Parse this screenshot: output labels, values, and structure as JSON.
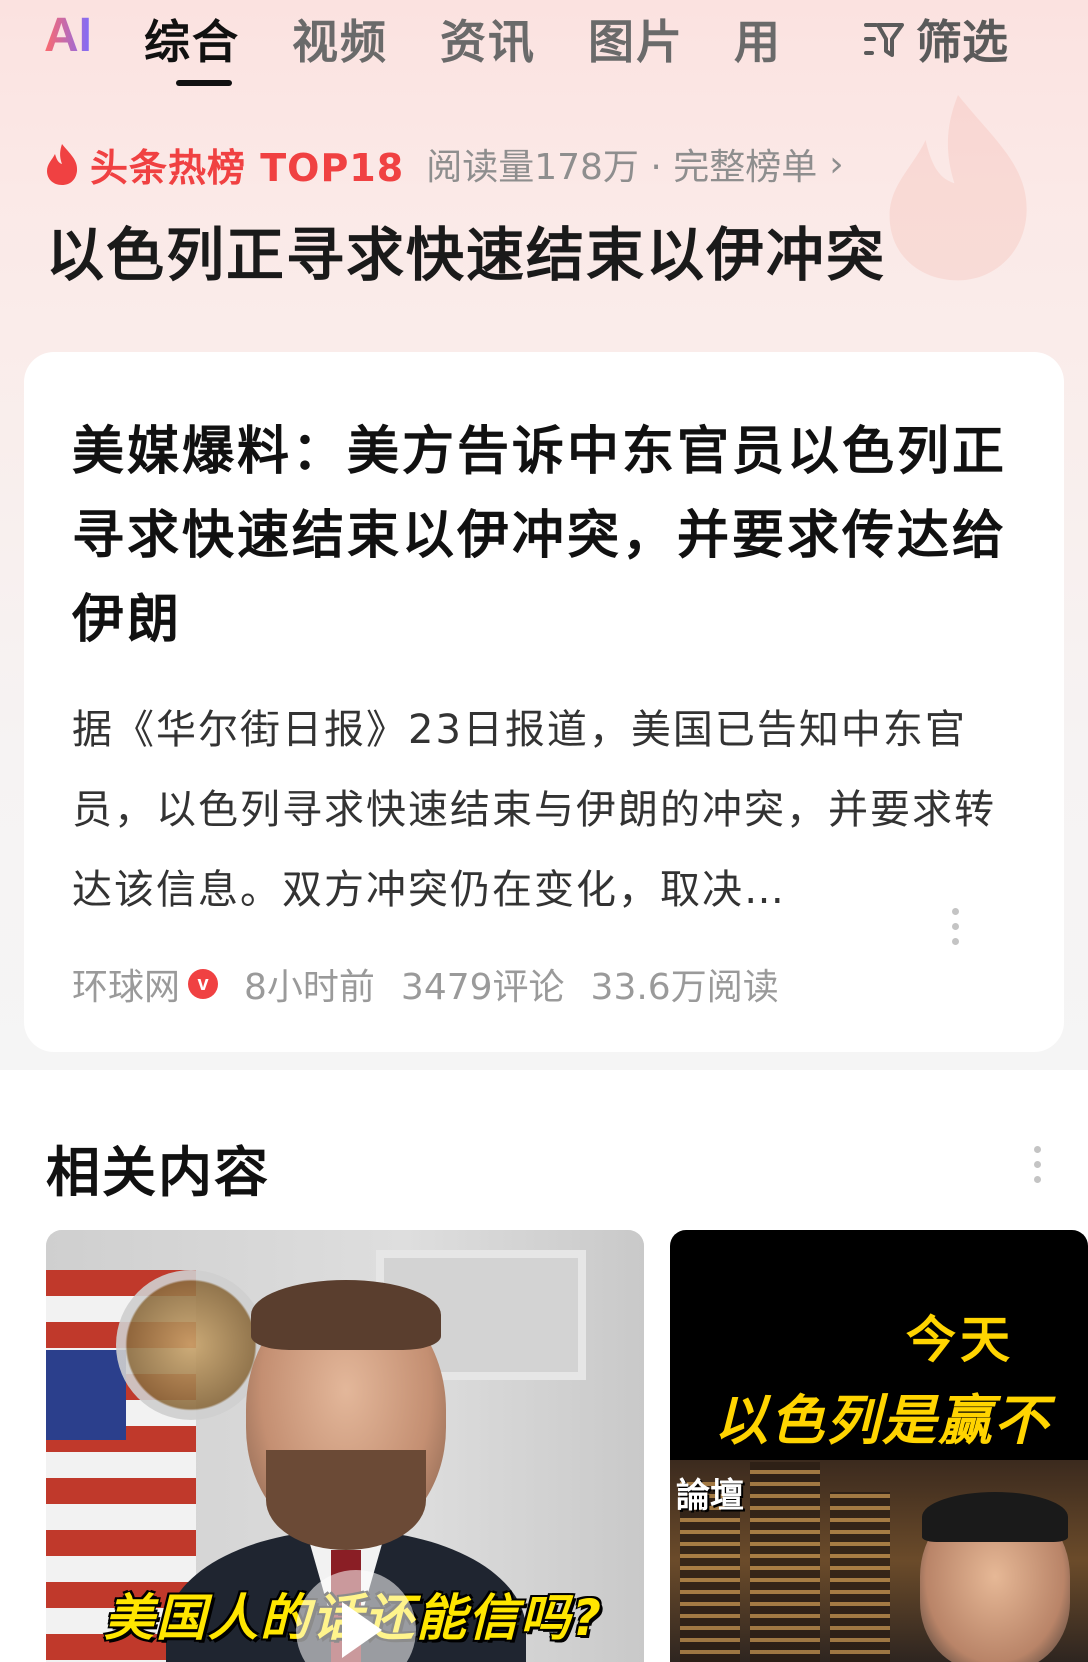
{
  "tabs": {
    "ai": "AI",
    "items": [
      "综合",
      "视频",
      "资讯",
      "图片",
      "用"
    ],
    "active_index": 0,
    "filter_label": "筛选"
  },
  "hot": {
    "badge": "头条热榜 TOP18",
    "meta": "阅读量178万 · 完整榜单",
    "chevron": "›",
    "headline": "以色列正寻求快速结束以伊冲突"
  },
  "article": {
    "title": "美媒爆料：美方告诉中东官员以色列正寻求快速结束以伊冲突，并要求传达给伊朗",
    "abstract": "据《华尔街日报》23日报道，美国已告知中东官员，以色列寻求快速结束与伊朗的冲突，并要求转达该信息。双方冲突仍在变化，取决…",
    "source": "环球网",
    "verified_mark": "v",
    "time": "8小时前",
    "comments": "3479评论",
    "reads": "33.6万阅读"
  },
  "related": {
    "title": "相关内容",
    "items": [
      {
        "caption": "美国人的话还能信吗?"
      },
      {
        "line1": "今天",
        "line2": "以色列是赢不",
        "label": "論壇"
      }
    ]
  },
  "colors": {
    "accent_red": "#f04142",
    "caption_yellow": "#ffe600"
  },
  "icons": [
    "flame-icon",
    "filter-icon",
    "chevron-right-icon",
    "verified-icon",
    "more-icon",
    "play-icon"
  ]
}
